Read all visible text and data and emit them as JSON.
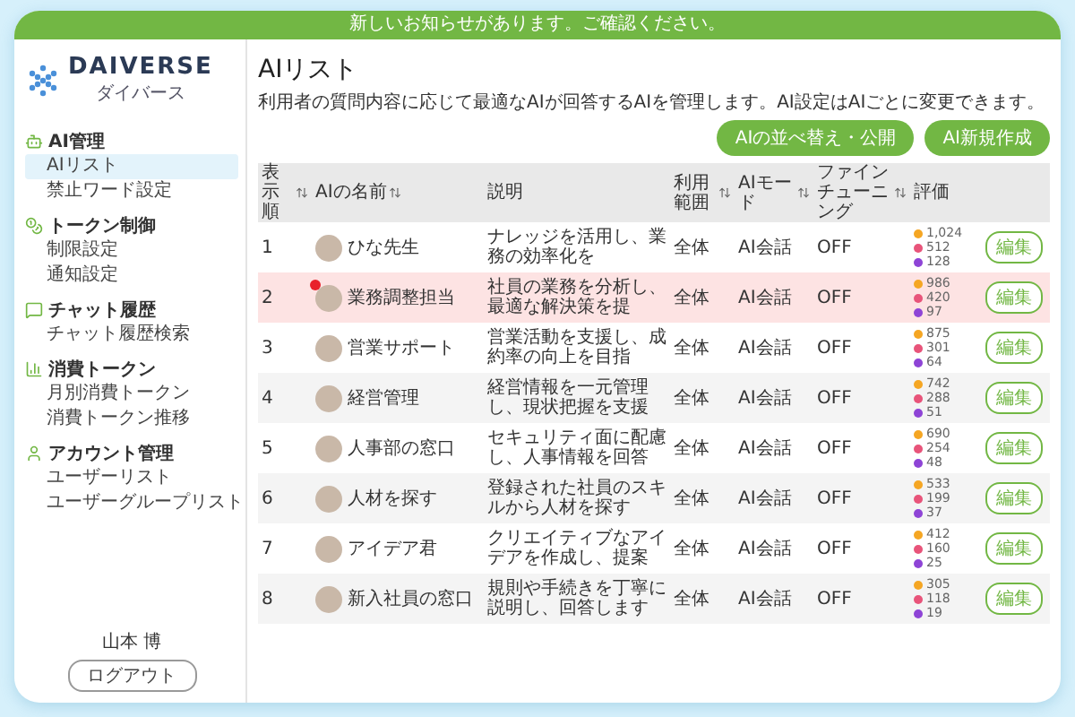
{
  "banner": "新しいお知らせがあります。ご確認ください。",
  "logo": {
    "name": "DAIVERSE",
    "sub": "ダイバース"
  },
  "sidebar": {
    "sections": [
      {
        "kind": "bot",
        "label": "AI管理",
        "items": [
          {
            "label": "AIリスト",
            "selected": true
          },
          {
            "label": "禁止ワード設定",
            "selected": false
          }
        ]
      },
      {
        "kind": "coin",
        "label": "トークン制御",
        "items": [
          {
            "label": "制限設定",
            "selected": false
          },
          {
            "label": "通知設定",
            "selected": false
          }
        ]
      },
      {
        "kind": "chat",
        "label": "チャット履歴",
        "items": [
          {
            "label": "チャット履歴検索",
            "selected": false
          }
        ]
      },
      {
        "kind": "chart",
        "label": "消費トークン",
        "items": [
          {
            "label": "月別消費トークン",
            "selected": false
          },
          {
            "label": "消費トークン推移",
            "selected": false
          }
        ]
      },
      {
        "kind": "user",
        "label": "アカウント管理",
        "items": [
          {
            "label": "ユーザーリスト",
            "selected": false
          },
          {
            "label": "ユーザーグループリスト",
            "selected": false
          }
        ]
      }
    ],
    "user": "山本 博",
    "logout": "ログアウト"
  },
  "page": {
    "title": "AIリスト",
    "description": "利用者の質問内容に応じて最適なAIが回答するAIを管理します。AI設定はAIごとに変更できます。",
    "buttons": [
      "AIの並べ替え・公開",
      "AI新規作成"
    ]
  },
  "table": {
    "columns": [
      {
        "label": "表示順",
        "sortable": true
      },
      {
        "label": "AIの名前",
        "sortable": true
      },
      {
        "label": "説明",
        "sortable": false
      },
      {
        "label": "利用範囲",
        "sortable": true
      },
      {
        "label": "AIモード",
        "sortable": true
      },
      {
        "label": "ファインチューニング",
        "sortable": true
      },
      {
        "label": "評価",
        "sortable": false
      }
    ],
    "rows": [
      {
        "order": "1",
        "name": "ひな先生",
        "description": "ナレッジを活用し、業務の効率化を",
        "scope": "全体",
        "mode": "AI会話",
        "finetune": "OFF",
        "selected": false,
        "notification": false,
        "ratings": [
          {
            "color": "#f5a623",
            "count": "1,024"
          },
          {
            "color": "#e8547a",
            "count": "512"
          },
          {
            "color": "#8e44d6",
            "count": "128"
          }
        ],
        "action": "編集"
      },
      {
        "order": "2",
        "name": "業務調整担当",
        "description": "社員の業務を分析し、最適な解決策を提",
        "scope": "全体",
        "mode": "AI会話",
        "finetune": "OFF",
        "selected": true,
        "notification": true,
        "ratings": [
          {
            "color": "#f5a623",
            "count": "986"
          },
          {
            "color": "#e8547a",
            "count": "420"
          },
          {
            "color": "#8e44d6",
            "count": "97"
          }
        ],
        "action": "編集"
      },
      {
        "order": "3",
        "name": "営業サポート",
        "description": "営業活動を支援し、成約率の向上を目指",
        "scope": "全体",
        "mode": "AI会話",
        "finetune": "OFF",
        "selected": false,
        "notification": false,
        "ratings": [
          {
            "color": "#f5a623",
            "count": "875"
          },
          {
            "color": "#e8547a",
            "count": "301"
          },
          {
            "color": "#8e44d6",
            "count": "64"
          }
        ],
        "action": "編集"
      },
      {
        "order": "4",
        "name": "経営管理",
        "description": "経営情報を一元管理し、現状把握を支援",
        "scope": "全体",
        "mode": "AI会話",
        "finetune": "OFF",
        "selected": false,
        "notification": false,
        "ratings": [
          {
            "color": "#f5a623",
            "count": "742"
          },
          {
            "color": "#e8547a",
            "count": "288"
          },
          {
            "color": "#8e44d6",
            "count": "51"
          }
        ],
        "action": "編集"
      },
      {
        "order": "5",
        "name": "人事部の窓口",
        "description": "セキュリティ面に配慮し、人事情報を回答",
        "scope": "全体",
        "mode": "AI会話",
        "finetune": "OFF",
        "selected": false,
        "notification": false,
        "ratings": [
          {
            "color": "#f5a623",
            "count": "690"
          },
          {
            "color": "#e8547a",
            "count": "254"
          },
          {
            "color": "#8e44d6",
            "count": "48"
          }
        ],
        "action": "編集"
      },
      {
        "order": "6",
        "name": "人材を探す",
        "description": "登録された社員のスキルから人材を探す",
        "scope": "全体",
        "mode": "AI会話",
        "finetune": "OFF",
        "selected": false,
        "notification": false,
        "ratings": [
          {
            "color": "#f5a623",
            "count": "533"
          },
          {
            "color": "#e8547a",
            "count": "199"
          },
          {
            "color": "#8e44d6",
            "count": "37"
          }
        ],
        "action": "編集"
      },
      {
        "order": "7",
        "name": "アイデア君",
        "description": "クリエイティブなアイデアを作成し、提案",
        "scope": "全体",
        "mode": "AI会話",
        "finetune": "OFF",
        "selected": false,
        "notification": false,
        "ratings": [
          {
            "color": "#f5a623",
            "count": "412"
          },
          {
            "color": "#e8547a",
            "count": "160"
          },
          {
            "color": "#8e44d6",
            "count": "25"
          }
        ],
        "action": "編集"
      },
      {
        "order": "8",
        "name": "新入社員の窓口",
        "description": "規則や手続きを丁寧に説明し、回答します",
        "scope": "全体",
        "mode": "AI会話",
        "finetune": "OFF",
        "selected": false,
        "notification": false,
        "ratings": [
          {
            "color": "#f5a623",
            "count": "305"
          },
          {
            "color": "#e8547a",
            "count": "118"
          },
          {
            "color": "#8e44d6",
            "count": "19"
          }
        ],
        "action": "編集"
      }
    ]
  }
}
